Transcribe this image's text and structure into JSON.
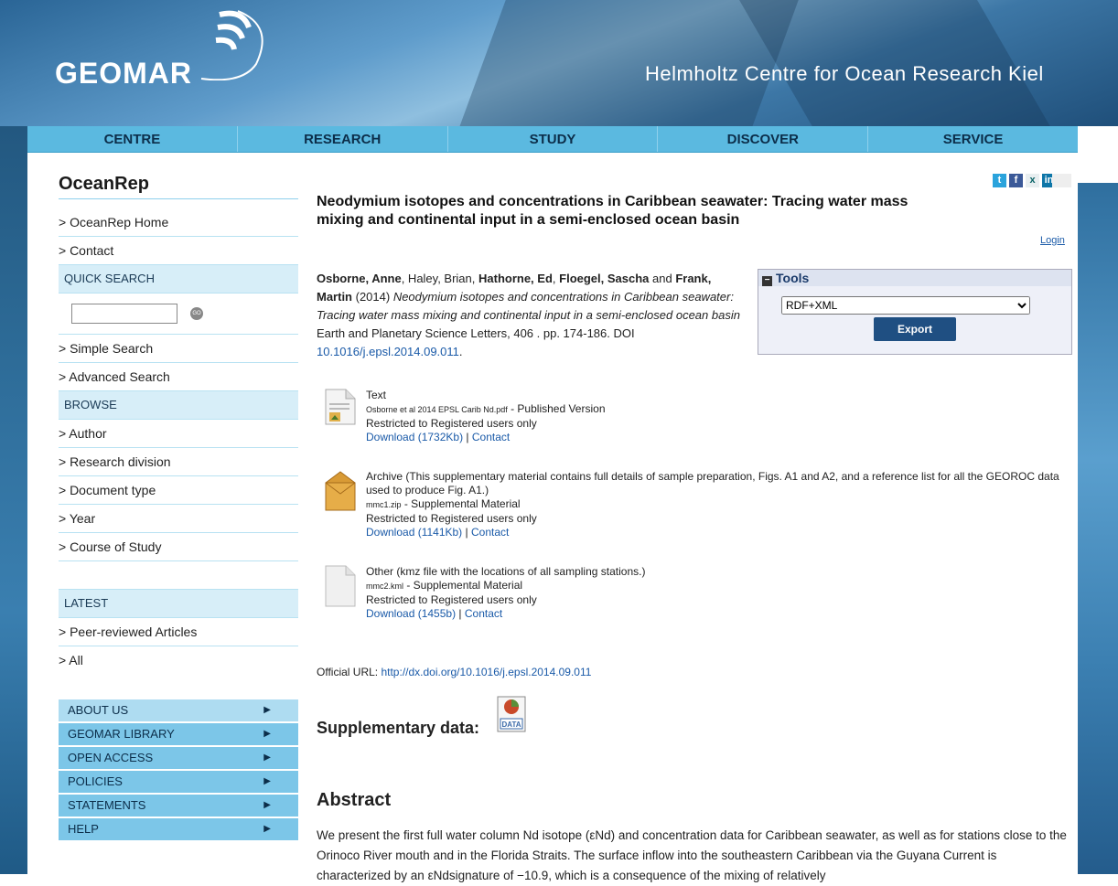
{
  "header": {
    "logo_text": "GEOMAR",
    "tagline": "Helmholtz Centre for Ocean Research Kiel"
  },
  "nav": [
    "CENTRE",
    "RESEARCH",
    "STUDY",
    "DISCOVER",
    "SERVICE"
  ],
  "sidebar": {
    "title": "OceanRep",
    "home": "> OceanRep Home",
    "contact": "> Contact",
    "quick_search": "QUICK SEARCH",
    "search_placeholder": "",
    "go_label": "GO",
    "simple_search": "> Simple Search",
    "advanced_search": "> Advanced Search",
    "browse": "BROWSE",
    "browse_items": [
      "> Author",
      "> Research division",
      "> Document type",
      "> Year",
      "> Course of Study"
    ],
    "latest": "LATEST",
    "latest_items": [
      "> Peer-reviewed Articles",
      "> All"
    ],
    "menu": [
      "ABOUT US",
      "GEOMAR LIBRARY",
      "OPEN ACCESS",
      "POLICIES",
      "STATEMENTS",
      "HELP"
    ]
  },
  "share": {
    "icons": [
      "twitter-icon",
      "facebook-icon",
      "xing-icon",
      "linkedin-icon"
    ],
    "twitter": "t",
    "facebook": "f",
    "xing": "x",
    "linkedin": "in"
  },
  "main": {
    "title": "Neodymium isotopes and concentrations in Caribbean seawater: Tracing water mass mixing and continental input in a semi-enclosed ocean basin",
    "login": "Login",
    "citation": {
      "a1": "Osborne, Anne",
      "sep1": ", Haley, Brian, ",
      "a3": "Hathorne, Ed",
      "sep2": ", ",
      "a4": "Floegel, Sascha",
      "and": " and ",
      "a5": "Frank, Martin",
      "year": " (2014) ",
      "title_italic": "Neodymium isotopes and concentrations in Caribbean seawater: Tracing water mass mixing and continental input in a semi-enclosed ocean basin",
      "journal": " Earth and Planetary Science Letters, 406 . pp. 174-186. DOI ",
      "doi": "10.1016/j.epsl.2014.09.011",
      "end": "."
    },
    "tools": {
      "title": "Tools",
      "format": "RDF+XML",
      "export": "Export"
    },
    "docs": [
      {
        "type": "Text",
        "filename": "Osborne et al 2014 EPSL Carib Nd.pdf",
        "version": " - Published Version",
        "restricted": "Restricted to Registered users only",
        "download": "Download (1732Kb)",
        "sep": " | ",
        "contact": "Contact"
      },
      {
        "type": "Archive (This supplementary material contains full details of sample preparation, Figs. A1 and A2, and a reference list for all the GEOROC data used to produce Fig. A1.)",
        "filename": "mmc1.zip",
        "version": " - Supplemental Material",
        "restricted": "Restricted to Registered users only",
        "download": "Download (1141Kb)",
        "sep": " | ",
        "contact": "Contact"
      },
      {
        "type": "Other (kmz file with the locations of all sampling stations.)",
        "filename": "mmc2.kml",
        "version": " - Supplemental Material",
        "restricted": "Restricted to Registered users only",
        "download": "Download (1455b)",
        "sep": " | ",
        "contact": "Contact"
      }
    ],
    "official_url_label": "Official URL: ",
    "official_url": "http://dx.doi.org/10.1016/j.epsl.2014.09.011",
    "supplementary": "Supplementary data:",
    "data_icon_label": "DATA",
    "abstract_heading": "Abstract",
    "abstract_text": "We present the first full water column Nd isotope (εNd) and concentration data for Caribbean seawater, as well as for stations close to the Orinoco River mouth and in the Florida Straits. The surface inflow into the southeastern Caribbean via the Guyana Current is characterized by an εNdsignature of −10.9, which is a consequence of the mixing of relatively"
  }
}
